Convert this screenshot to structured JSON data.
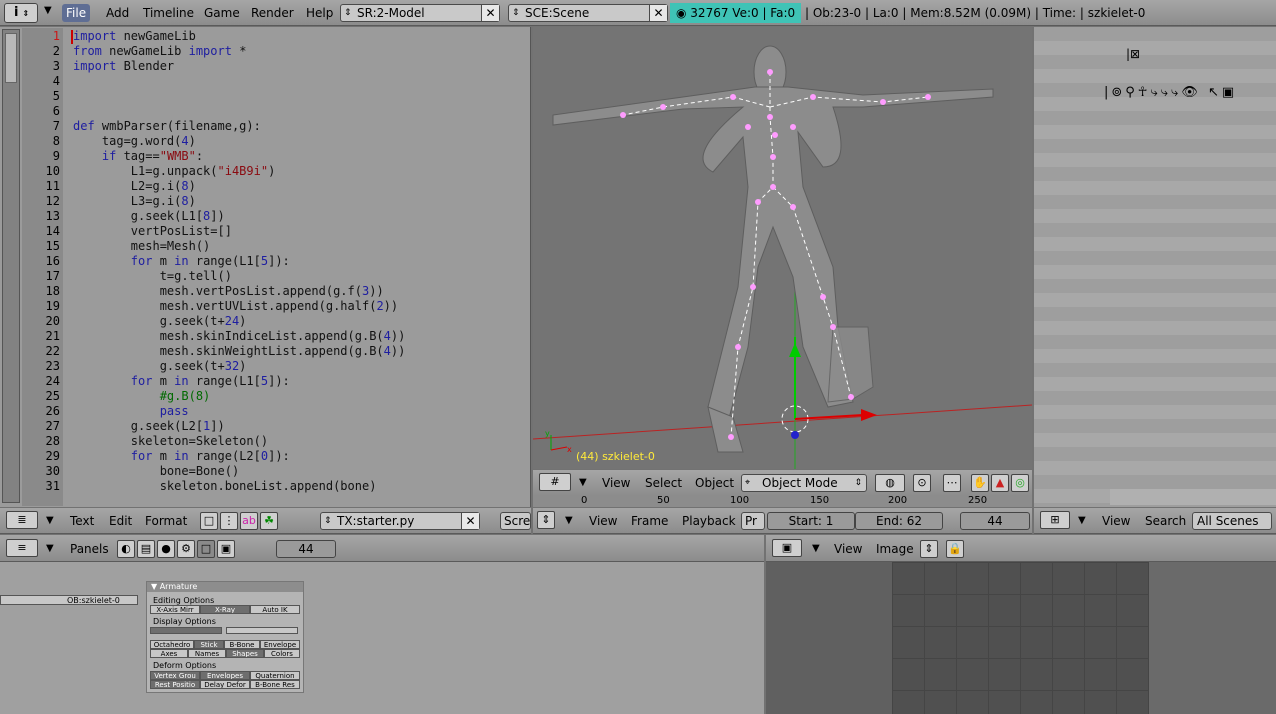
{
  "topbar": {
    "menus": [
      "File",
      "Add",
      "Timeline",
      "Game",
      "Render",
      "Help"
    ],
    "screen": "SR:2-Model",
    "scene": "SCE:Scene",
    "stats_teal": "32767   Ve:0 | Fa:0",
    "stats_rest": "| Ob:23-0 | La:0  | Mem:8.52M (0.09M)  | Time: | szkielet-0"
  },
  "editor": {
    "line_numbers": [
      "1",
      "2",
      "3",
      "4",
      "5",
      "6",
      "7",
      "8",
      "9",
      "10",
      "11",
      "12",
      "13",
      "14",
      "15",
      "16",
      "17",
      "18",
      "19",
      "20",
      "21",
      "22",
      "23",
      "24",
      "25",
      "26",
      "27",
      "28",
      "29",
      "30",
      "31"
    ]
  },
  "text_header": {
    "menus": [
      "Text",
      "Edit",
      "Format"
    ],
    "file": "TX:starter.py",
    "script": "Scre"
  },
  "view3d": {
    "object_label": "(44) szkielet-0",
    "menus": [
      "View",
      "Select",
      "Object"
    ],
    "mode": "Object Mode",
    "ruler": [
      "0",
      "50",
      "100",
      "150",
      "200",
      "250"
    ]
  },
  "timeline_header": {
    "menus": [
      "View",
      "Frame",
      "Playback"
    ],
    "pr": "Pr",
    "start": "Start: 1",
    "end": "End: 62",
    "current": "44"
  },
  "outliner_header": {
    "menus": [
      "View",
      "Search"
    ],
    "scope": "All Scenes"
  },
  "buttons_header": {
    "panels": "Panels",
    "frame": "44"
  },
  "armature_panel": {
    "title": "Armature",
    "ob_name": "OB:szkielet-0",
    "editing_options": "Editing Options",
    "x_axis_mirror": "X-Axis Mirr",
    "x_ray": "X-Ray",
    "auto_ik": "Auto IK",
    "display_options": "Display Options",
    "octahedron": "Octahedro",
    "stick": "Stick",
    "bbone": "B-Bone",
    "envelope": "Envelope",
    "axes": "Axes",
    "names": "Names",
    "shapes": "Shapes",
    "colors": "Colors",
    "deform_options": "Deform Options",
    "vertex_groups": "Vertex Grou",
    "envelopes": "Envelopes",
    "quaternion": "Quaternion",
    "rest_position": "Rest Positio",
    "delay_deform": "Delay Defor",
    "bbone_rest": "B-Bone Res"
  },
  "image_header": {
    "menus": [
      "View",
      "Image"
    ]
  }
}
